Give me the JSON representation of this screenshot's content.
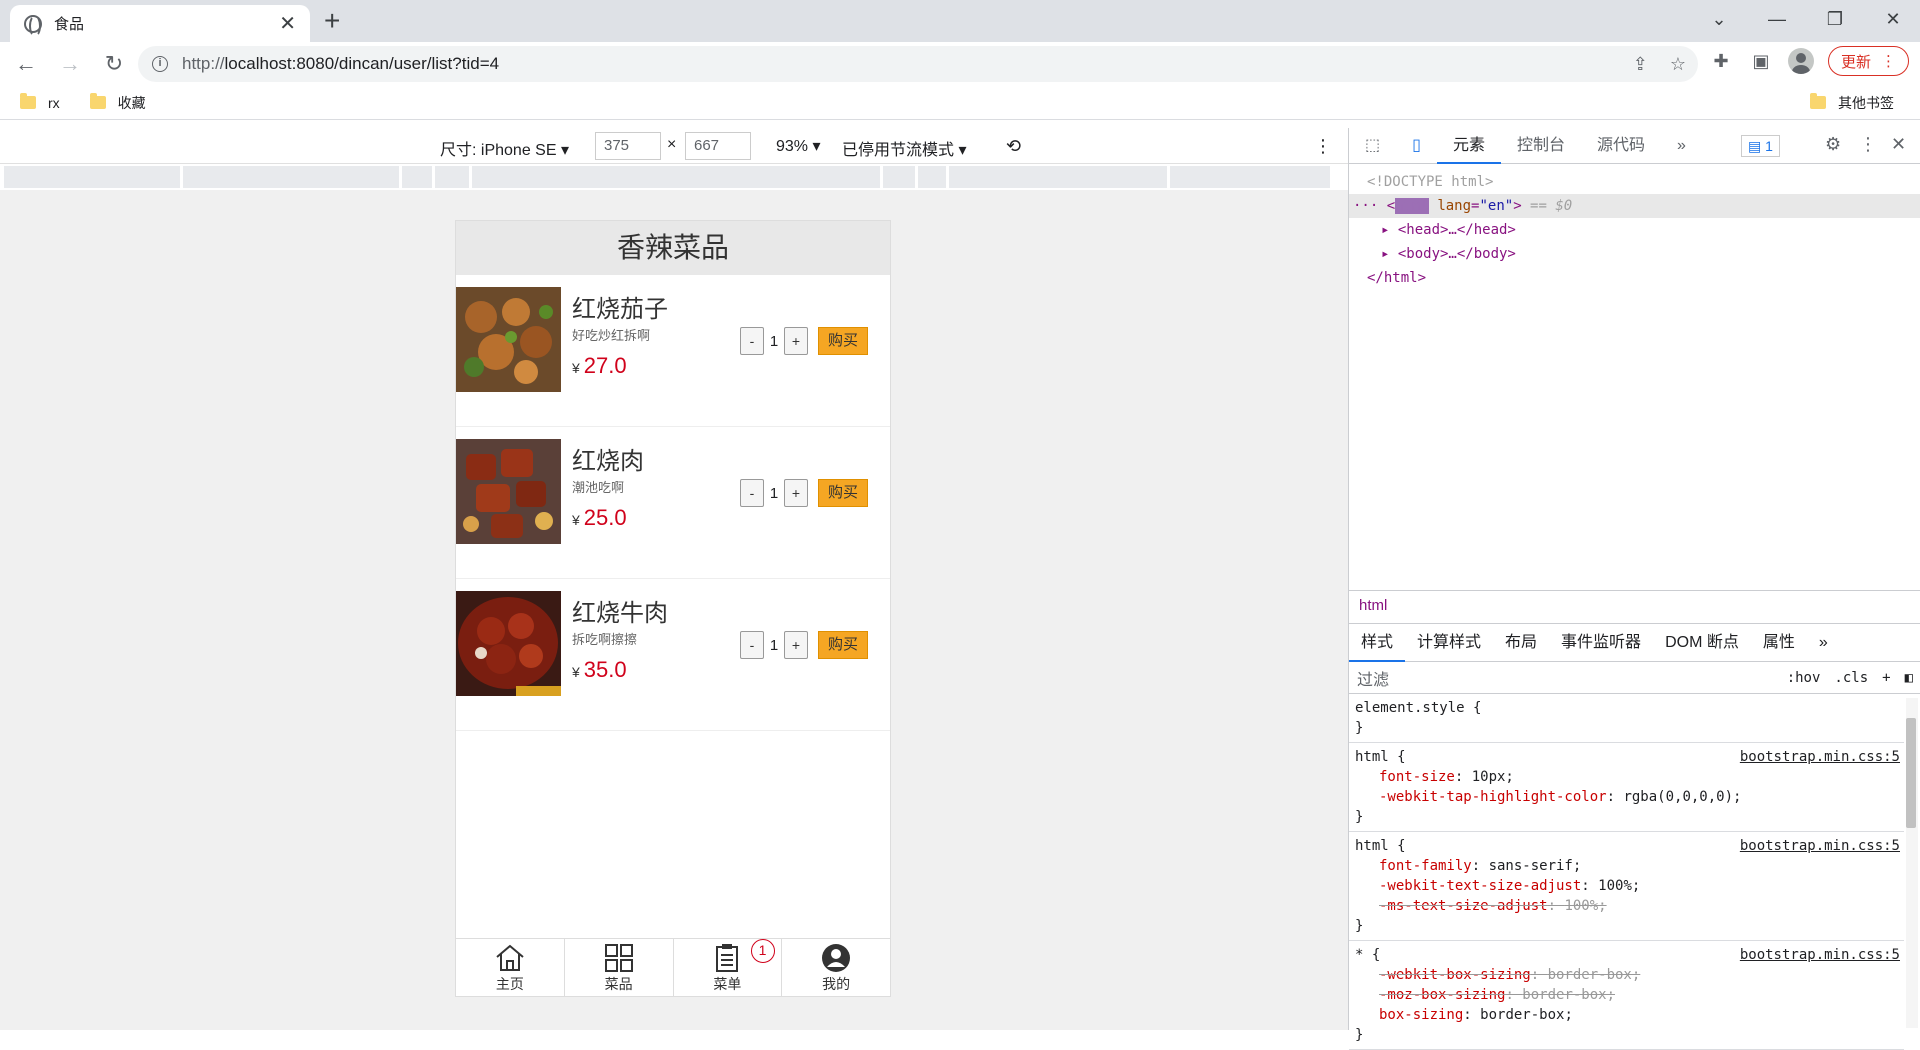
{
  "browser": {
    "tab_title": "食品",
    "url_prefix": "http://",
    "url_main": "localhost:8080/dincan/user/list?tid=4",
    "update_label": "更新",
    "bookmarks": [
      "rx",
      "收藏"
    ],
    "other_bookmarks": "其他书签"
  },
  "devbar": {
    "size_label": "尺寸: iPhone SE",
    "width": "375",
    "height": "667",
    "times": "×",
    "zoom": "93%",
    "throttle": "已停用节流模式"
  },
  "app": {
    "header_title": "香辣菜品",
    "currency": "¥",
    "minus": "-",
    "plus": "+",
    "buy_label": "购买",
    "foods": [
      {
        "name": "红烧茄子",
        "desc": "好吃炒红拆啊",
        "price": "27.0",
        "qty": "1"
      },
      {
        "name": "红烧肉",
        "desc": "潮池吃啊",
        "price": "25.0",
        "qty": "1"
      },
      {
        "name": "红烧牛肉",
        "desc": "拆吃啊擦擦",
        "price": "35.0",
        "qty": "1"
      }
    ],
    "nav": [
      {
        "label": "主页",
        "icon": "home-icon"
      },
      {
        "label": "菜品",
        "icon": "grid-icon"
      },
      {
        "label": "菜单",
        "icon": "clipboard-icon",
        "badge": "1"
      },
      {
        "label": "我的",
        "icon": "user-icon"
      }
    ]
  },
  "devtools": {
    "tabs": [
      "元素",
      "控制台",
      "源代码"
    ],
    "issues_count": "1",
    "dom_lines": {
      "doctype": "<!DOCTYPE html>",
      "html_open_tag": "html",
      "html_attr": "lang",
      "html_attr_val": "\"en\"",
      "html_suffix": "== $0",
      "head": "<head>…</head>",
      "body": "<body>…</body>",
      "html_close": "</html>"
    },
    "breadcrumb": "html",
    "style_tabs": [
      "样式",
      "计算样式",
      "布局",
      "事件监听器",
      "DOM 断点",
      "属性"
    ],
    "filter_placeholder": "过滤",
    "hov": ":hov",
    "cls": ".cls",
    "rules": [
      {
        "selector": "element.style {",
        "source": "",
        "props": []
      },
      {
        "selector": "html {",
        "source": "bootstrap.min.css:5",
        "props": [
          {
            "name": "font-size",
            "value": "10px;",
            "struck": false
          },
          {
            "name": "-webkit-tap-highlight-color",
            "value": "rgba(0,0,0,0);",
            "struck": false
          }
        ]
      },
      {
        "selector": "html {",
        "source": "bootstrap.min.css:5",
        "props": [
          {
            "name": "font-family",
            "value": "sans-serif;",
            "struck": false
          },
          {
            "name": "-webkit-text-size-adjust",
            "value": "100%;",
            "struck": false
          },
          {
            "name": "-ms-text-size-adjust",
            "value": "100%;",
            "struck": true
          }
        ]
      },
      {
        "selector": "* {",
        "source": "bootstrap.min.css:5",
        "props": [
          {
            "name": "-webkit-box-sizing",
            "value": "border-box;",
            "struck": true
          },
          {
            "name": "-moz-box-sizing",
            "value": "border-box;",
            "struck": true
          },
          {
            "name": "box-sizing",
            "value": "border-box;",
            "struck": false
          }
        ]
      }
    ]
  }
}
